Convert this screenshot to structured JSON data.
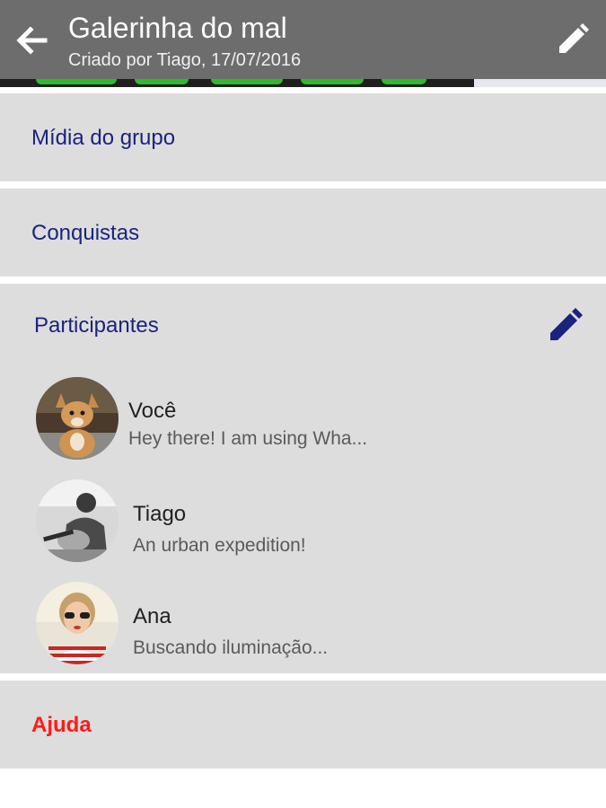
{
  "header": {
    "title": "Galerinha do mal",
    "subtitle": "Criado por Tiago, 17/07/2016",
    "back_icon": "arrow-left-icon",
    "edit_icon": "pencil-icon"
  },
  "sections": {
    "media": "Mídia do grupo",
    "achievements": "Conquistas",
    "participants": "Participantes",
    "help": "Ajuda"
  },
  "participants": [
    {
      "name": "Você",
      "status": "Hey there! I am using Wha...",
      "avatar": "dog-avatar"
    },
    {
      "name": "Tiago",
      "status": "An urban expedition!",
      "avatar": "guitar-player-avatar"
    },
    {
      "name": "Ana",
      "status": "Buscando iluminação...",
      "avatar": "woman-sunglasses-avatar"
    }
  ],
  "colors": {
    "appbar": "#6d6d6d",
    "section_bg": "#dddddd",
    "label_blue": "#1a237e",
    "help_red": "#ff1a1a"
  }
}
